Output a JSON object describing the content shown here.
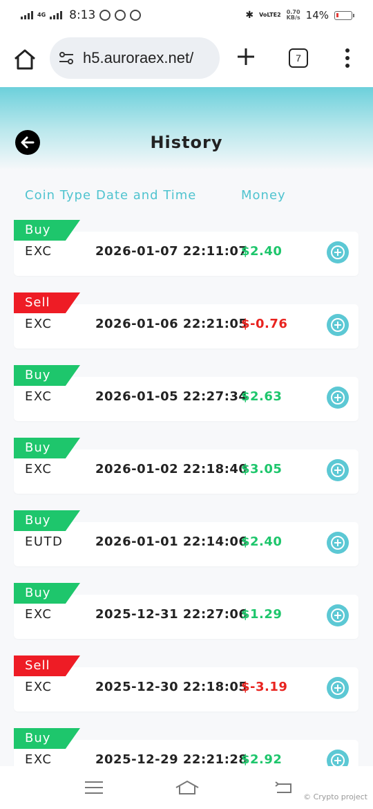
{
  "status_bar": {
    "network": "4G",
    "time": "8:13",
    "volte": "VoLTE2",
    "speed_value": "0.70",
    "speed_unit": "KB/s",
    "battery": "14%"
  },
  "browser": {
    "url": "h5.auroraex.net/",
    "tab_count": "7"
  },
  "page": {
    "title": "History"
  },
  "columns": {
    "coin_type": "Coin Type",
    "date_time": "Date and Time",
    "money": "Money"
  },
  "rows": [
    {
      "tag": "Buy",
      "coin": "EXC",
      "datetime": "2026-01-07 22:11:07",
      "money": "$2.40"
    },
    {
      "tag": "Sell",
      "coin": "EXC",
      "datetime": "2026-01-06 22:21:05",
      "money": "$-0.76"
    },
    {
      "tag": "Buy",
      "coin": "EXC",
      "datetime": "2026-01-05 22:27:34",
      "money": "$2.63"
    },
    {
      "tag": "Buy",
      "coin": "EXC",
      "datetime": "2026-01-02 22:18:40",
      "money": "$3.05"
    },
    {
      "tag": "Buy",
      "coin": "EUTD",
      "datetime": "2026-01-01 22:14:06",
      "money": "$2.40"
    },
    {
      "tag": "Buy",
      "coin": "EXC",
      "datetime": "2025-12-31 22:27:06",
      "money": "$1.29"
    },
    {
      "tag": "Sell",
      "coin": "EXC",
      "datetime": "2025-12-30 22:18:05",
      "money": "$-3.19"
    },
    {
      "tag": "Buy",
      "coin": "EXC",
      "datetime": "2025-12-29 22:21:28",
      "money": "$2.92"
    }
  ],
  "watermark": "© Crypto project",
  "colors": {
    "accent": "#4fc3cf",
    "buy": "#1ec66c",
    "sell": "#ee1c25"
  }
}
